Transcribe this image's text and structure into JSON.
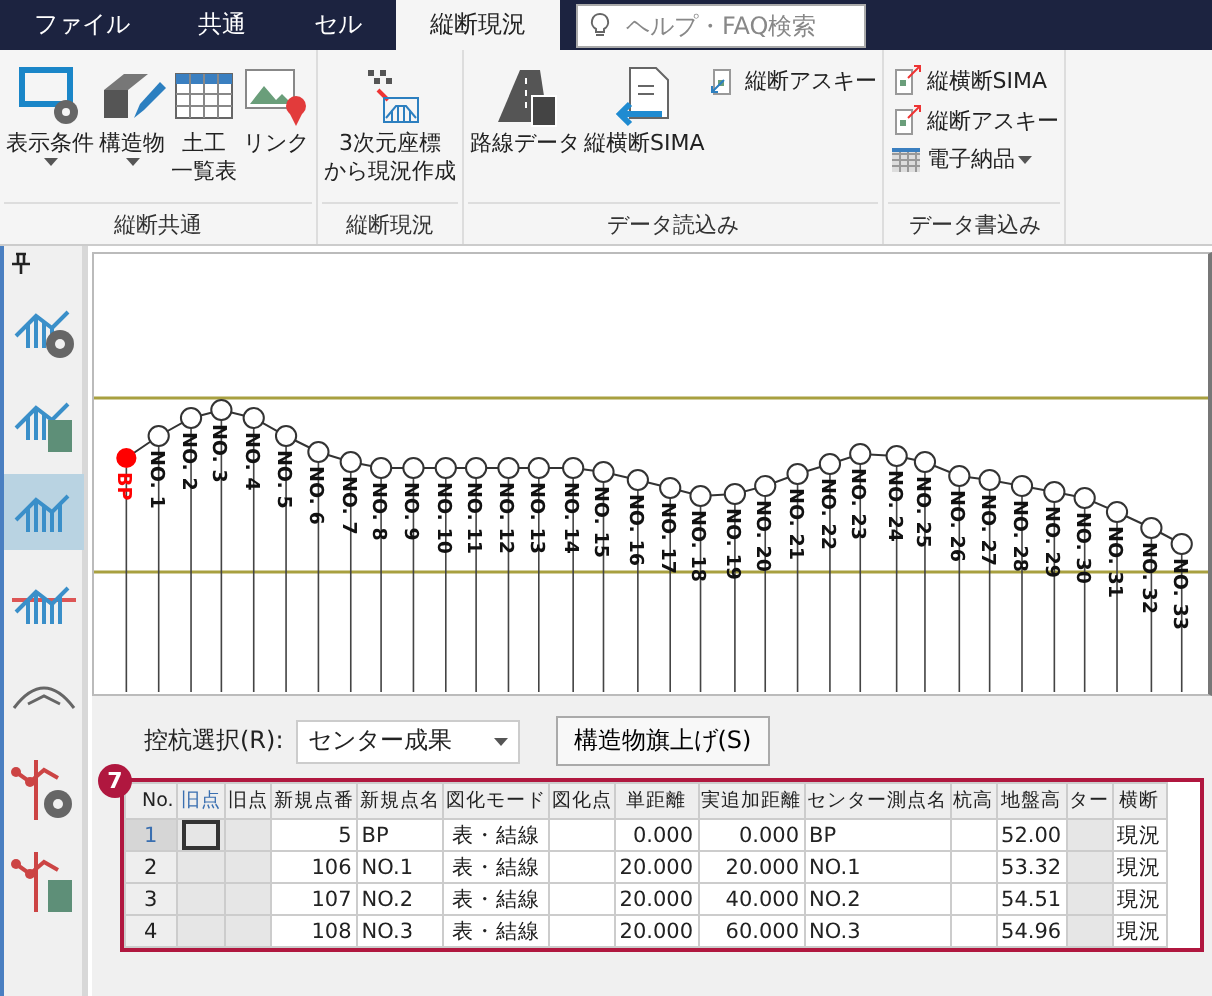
{
  "ribbon_tabs": [
    {
      "label": "ファイル",
      "selected": false
    },
    {
      "label": "共通",
      "selected": false
    },
    {
      "label": "セル",
      "selected": false
    },
    {
      "label": "縦断現況",
      "selected": true
    }
  ],
  "search": {
    "placeholder": "ヘルプ・FAQ検索"
  },
  "ribbon_groups": [
    {
      "title": "縦断共通",
      "items": [
        {
          "kind": "large",
          "lines": [
            "表示条件"
          ],
          "dropdown": true
        },
        {
          "kind": "large",
          "lines": [
            "構造物"
          ],
          "dropdown": true
        },
        {
          "kind": "large",
          "lines": [
            "土工",
            "一覧表"
          ],
          "dropdown": false
        },
        {
          "kind": "large",
          "lines": [
            "リンク"
          ],
          "dropdown": false
        }
      ]
    },
    {
      "title": "縦断現況",
      "items": [
        {
          "kind": "large",
          "lines": [
            "3次元座標",
            "から現況作成"
          ],
          "dropdown": false
        }
      ]
    },
    {
      "title": "データ読込み",
      "items": [
        {
          "kind": "large",
          "lines": [
            "路線データ"
          ],
          "dropdown": false
        },
        {
          "kind": "large",
          "lines": [
            "縦横断SIMA"
          ],
          "dropdown": false
        },
        {
          "kind": "small",
          "label": "縦断アスキー",
          "dropdown": false
        }
      ]
    },
    {
      "title": "データ書込み",
      "items": [
        {
          "kind": "small",
          "label": "縦横断SIMA",
          "dropdown": false
        },
        {
          "kind": "small",
          "label": "縦断アスキー",
          "dropdown": false
        },
        {
          "kind": "small",
          "label": "電子納品",
          "dropdown": true
        }
      ]
    }
  ],
  "sidebar": {
    "tools": [
      {
        "selected": false
      },
      {
        "selected": false
      },
      {
        "selected": true
      },
      {
        "selected": false
      },
      {
        "selected": false
      },
      {
        "selected": false
      },
      {
        "selected": false
      }
    ]
  },
  "profile": {
    "stations": [
      {
        "label": "BP",
        "kind": "start"
      },
      {
        "label": "NO. 1",
        "kind": "station"
      },
      {
        "label": "NO. 2",
        "kind": "station"
      },
      {
        "label": "NO. 3",
        "kind": "station"
      },
      {
        "label": "NO. 4",
        "kind": "station"
      },
      {
        "label": "NO. 5",
        "kind": "station"
      },
      {
        "label": "NO. 6",
        "kind": "station"
      },
      {
        "label": "NO. 7",
        "kind": "station"
      },
      {
        "label": "NO. 8",
        "kind": "station"
      },
      {
        "label": "NO. 9",
        "kind": "station"
      },
      {
        "label": "NO. 10",
        "kind": "station"
      },
      {
        "label": "NO. 11",
        "kind": "station"
      },
      {
        "label": "NO. 12",
        "kind": "station"
      },
      {
        "label": "NO. 13",
        "kind": "station"
      },
      {
        "label": "NO. 14",
        "kind": "station"
      },
      {
        "label": "NO. 15",
        "kind": "station"
      },
      {
        "label": "NO. 16",
        "kind": "station"
      },
      {
        "label": "NO. 17",
        "kind": "station"
      },
      {
        "label": "NO. 18",
        "kind": "station"
      },
      {
        "label": "NO. 19",
        "kind": "station"
      },
      {
        "label": "NO. 20",
        "kind": "station"
      },
      {
        "label": "NO. 21",
        "kind": "station"
      },
      {
        "label": "NO. 22",
        "kind": "station"
      },
      {
        "label": "NO. 23",
        "kind": "station"
      },
      {
        "label": "NO. 24",
        "kind": "station"
      },
      {
        "label": "NO. 25",
        "kind": "station"
      },
      {
        "label": "NO. 26",
        "kind": "station"
      },
      {
        "label": "NO. 27",
        "kind": "station"
      },
      {
        "label": "NO. 28",
        "kind": "station"
      },
      {
        "label": "NO. 29",
        "kind": "station"
      },
      {
        "label": "NO. 30",
        "kind": "station"
      },
      {
        "label": "NO. 31",
        "kind": "station"
      },
      {
        "label": "NO. 32",
        "kind": "station"
      },
      {
        "label": "NO. 33",
        "kind": "station"
      }
    ]
  },
  "controls": {
    "select_label": "控杭選択(R):",
    "select_value": "センター成果",
    "flag_button": "構造物旗上げ(S)",
    "callout": "7"
  },
  "table": {
    "columns": [
      "No.",
      "旧点",
      "旧点",
      "新規点番",
      "新規点名",
      "図化モード",
      "図化点",
      "単距離",
      "実追加距離",
      "センター測点名",
      "杭高",
      "地盤高",
      "ター",
      "横断"
    ],
    "rows": [
      {
        "selected": true,
        "cells": [
          "1",
          "",
          "",
          "5",
          "BP",
          "表・結線",
          "",
          "0.000",
          "0.000",
          "BP",
          "",
          "52.00",
          "",
          "現況"
        ]
      },
      {
        "selected": false,
        "cells": [
          "2",
          "",
          "",
          "106",
          "NO.1",
          "表・結線",
          "",
          "20.000",
          "20.000",
          "NO.1",
          "",
          "53.32",
          "",
          "現況"
        ]
      },
      {
        "selected": false,
        "cells": [
          "3",
          "",
          "",
          "107",
          "NO.2",
          "表・結線",
          "",
          "20.000",
          "40.000",
          "NO.2",
          "",
          "54.51",
          "",
          "現況"
        ]
      },
      {
        "selected": false,
        "cells": [
          "4",
          "",
          "",
          "108",
          "NO.3",
          "表・結線",
          "",
          "20.000",
          "60.000",
          "NO.3",
          "",
          "54.96",
          "",
          "現況"
        ]
      }
    ]
  }
}
